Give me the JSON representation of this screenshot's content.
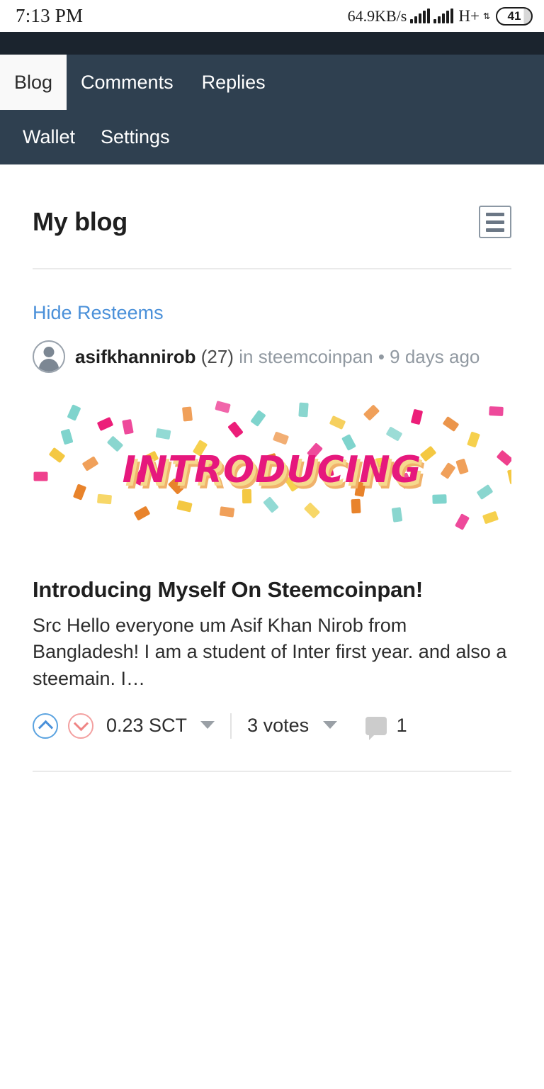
{
  "statusbar": {
    "time": "7:13 PM",
    "network_speed": "64.9KB/s",
    "network_type": "H+",
    "data_arrows": "⇅",
    "battery_level": "41",
    "signal_icon": "signal-bars-icon"
  },
  "nav": {
    "row1": [
      {
        "label": "Blog",
        "active": true
      },
      {
        "label": "Comments",
        "active": false
      },
      {
        "label": "Replies",
        "active": false
      }
    ],
    "row2": [
      {
        "label": "Wallet",
        "active": false
      },
      {
        "label": "Settings",
        "active": false
      }
    ],
    "bg_color": "#2f4050",
    "active_bg_color": "#f9f9f9"
  },
  "page": {
    "title": "My blog",
    "menu_button_label": "menu",
    "hide_resteems_label": "Hide Resteems",
    "link_color": "#4a90d9"
  },
  "post": {
    "author": "asifkhannirob",
    "reputation": "(27)",
    "community_prefix": "in",
    "community": "steemcoinpan",
    "separator": "•",
    "age": "9 days ago",
    "thumbnail_text": "INTRODUCING",
    "thumbnail_text_color": "#e6187d",
    "title": "Introducing Myself On Steemcoinpan!",
    "excerpt": "Src Hello everyone um Asif Khan Nirob from Bangladesh! I am a student of Inter first year. and also a steemain. I…",
    "payout": "0.23 SCT",
    "votes": "3 votes",
    "comment_count": "1",
    "upvote_color": "#4a90d9",
    "downvote_color": "#ef8585"
  }
}
